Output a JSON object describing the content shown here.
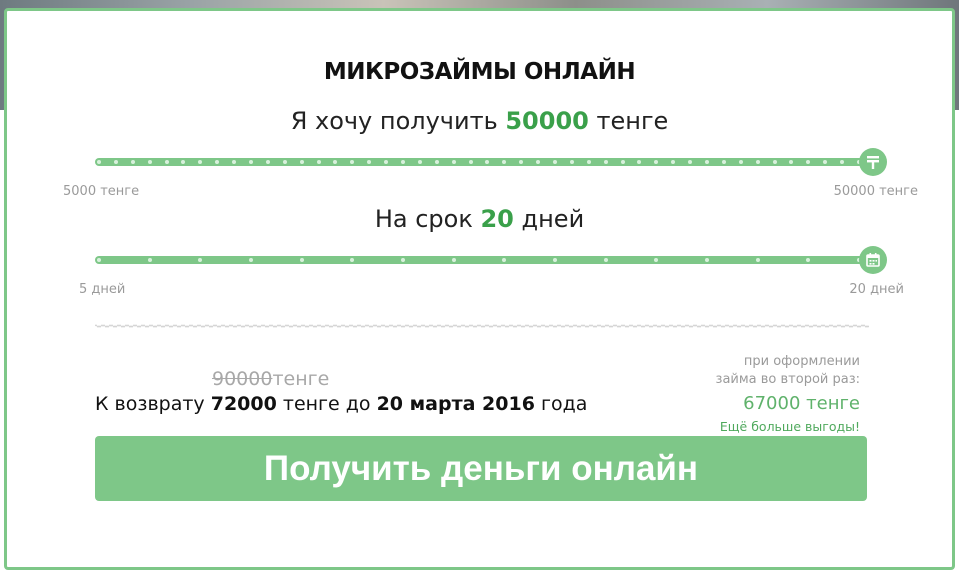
{
  "title": "МИКРОЗАЙМЫ ОНЛАЙН",
  "amount": {
    "prefix": "Я хочу получить",
    "value": "50000",
    "suffix": "тенге",
    "min_label": "5000 тенге",
    "max_label": "50000 тенге",
    "slider_value_fraction": 1.0,
    "handle_icon": "tenge-icon"
  },
  "term": {
    "prefix": "На срок",
    "value": "20",
    "suffix": "дней",
    "min_label": "5 дней",
    "max_label": "20 дней",
    "slider_value_fraction": 1.0,
    "handle_icon": "calendar-icon"
  },
  "summary": {
    "old_amount": "90000",
    "old_currency": "тенге",
    "repay_prefix": "К возврату",
    "repay_amount": "72000",
    "repay_mid": "тенге до",
    "repay_date": "20 марта 2016",
    "repay_suffix": "года"
  },
  "second_loan": {
    "caption_line1": "при оформлении",
    "caption_line2": "займа во второй раз:",
    "amount": "67000 тенге",
    "promo": "Ещё больше выгоды!"
  },
  "cta_label": "Получить деньги онлайн",
  "colors": {
    "accent": "#7ec788",
    "value_green": "#3aa04a"
  }
}
